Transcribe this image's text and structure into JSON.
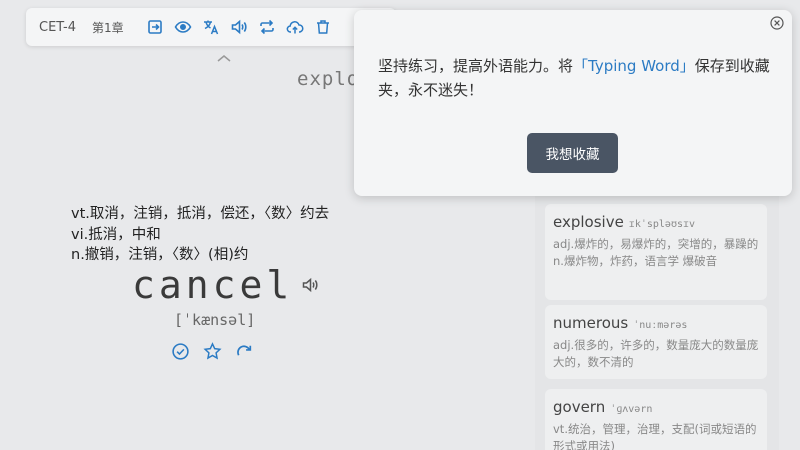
{
  "toolbar": {
    "dict_label": "CET-4",
    "chapter_label": "第1章",
    "icons": [
      "exit-icon",
      "eye-icon",
      "translate-icon",
      "speaker-icon",
      "repeat-icon",
      "cloud-upload-icon",
      "delete-icon"
    ]
  },
  "main": {
    "prev_word": "explo",
    "definitions": [
      "vt.取消，注销，抵消，偿还，〈数〉约去",
      "vi.抵消，中和",
      "n.撤销，注销，〈数〉(相)约"
    ],
    "word": "cancel",
    "phonetic": "[ˈkænsəl]"
  },
  "word_list": [
    {
      "word": "explosive",
      "phonetic": "ɪkˈspləʊsɪv",
      "definitions": [
        "adj.爆炸的，易爆炸的，突增的，暴躁的",
        "n.爆炸物，炸药，语言学 爆破音"
      ]
    },
    {
      "word": "numerous",
      "phonetic": "ˈnuːmərəs",
      "definitions": [
        "adj.很多的，许多的，数量庞大的数量庞大的，数不清的"
      ]
    },
    {
      "word": "govern",
      "phonetic": "ˈɡʌvərn",
      "definitions": [
        "vt.统治，管理，治理，支配(词或短语的形式或用法)"
      ]
    }
  ],
  "popup": {
    "text_before": "坚持练习，提高外语能力。将",
    "link_text": "「Typing Word」",
    "text_after": "保存到收藏夹，永不迷失！",
    "button_label": "我想收藏"
  },
  "colors": {
    "accent": "#2b7bc4",
    "button_bg": "#4a5564",
    "background": "#e8e9eb"
  }
}
